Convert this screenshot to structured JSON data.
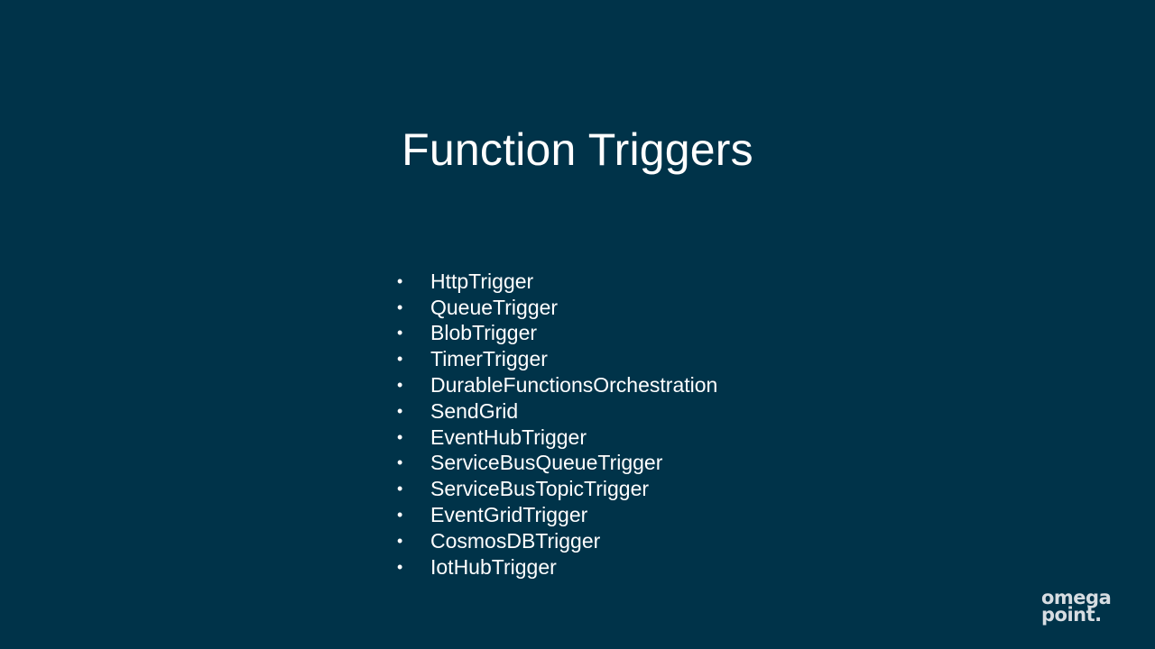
{
  "slide": {
    "title": "Function Triggers",
    "bullet_symbol": "•",
    "items": [
      "HttpTrigger",
      "QueueTrigger",
      "BlobTrigger",
      "TimerTrigger",
      "DurableFunctionsOrchestration",
      "SendGrid",
      "EventHubTrigger",
      "ServiceBusQueueTrigger",
      "ServiceBusTopicTrigger",
      "EventGridTrigger",
      "CosmosDBTrigger",
      "IotHubTrigger"
    ]
  },
  "logo": {
    "line1": "omega",
    "line2": "point."
  },
  "colors": {
    "background": "#003349",
    "text": "#ffffff",
    "logo": "#d7dde2"
  }
}
